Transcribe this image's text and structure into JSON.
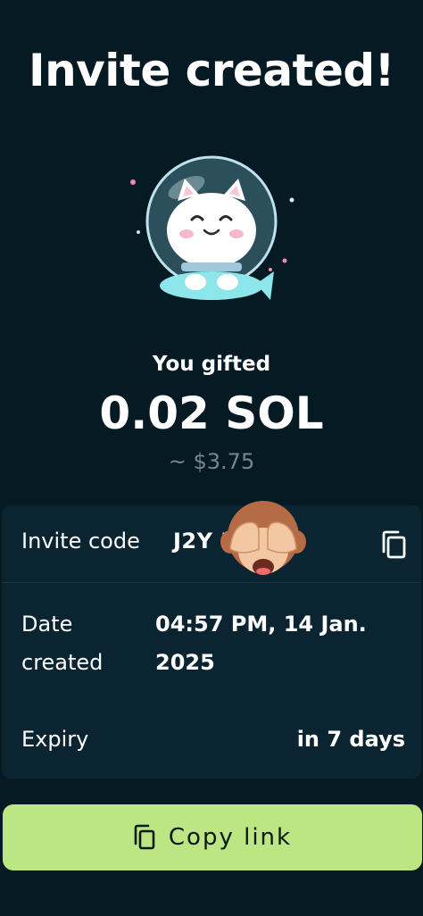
{
  "header": {
    "title": "Invite created!"
  },
  "hero": {
    "image": "astronaut-cat-illustration"
  },
  "gift": {
    "label": "You gifted",
    "amount": "0.02 SOL",
    "fiat": "~ $3.75"
  },
  "details": {
    "invite_code_label": "Invite code",
    "invite_code_value": "J2Y        RRd7",
    "date_label": "Date created",
    "date_value": "04:57 PM, 14 Jan. 2025",
    "expiry_label": "Expiry",
    "expiry_value": "in 7 days"
  },
  "overlay": {
    "emoji": "see-no-evil-monkey-emoji"
  },
  "actions": {
    "copy_link_label": "Copy link"
  },
  "colors": {
    "background": "#061a24",
    "card": "#0b2432",
    "accent_button": "#bce583",
    "muted_text": "#76868f"
  }
}
